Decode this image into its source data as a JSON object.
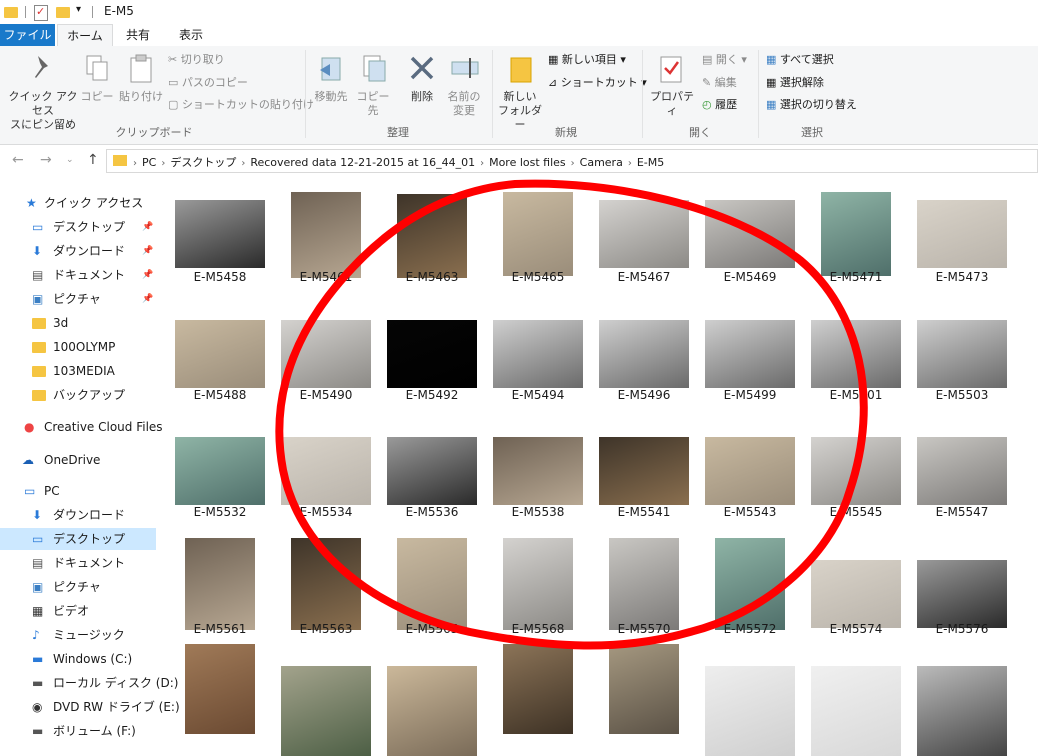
{
  "window": {
    "title": "E-M5"
  },
  "tabs": {
    "file": "ファイル",
    "home": "ホーム",
    "share": "共有",
    "view": "表示"
  },
  "ribbon": {
    "clipboard": {
      "label": "クリップボード",
      "pin": "クイック アクセス\nスにピン留め",
      "copy": "コピー",
      "paste": "貼り付け",
      "cut": "切り取り",
      "copy_path": "パスのコピー",
      "paste_shortcut": "ショートカットの貼り付け"
    },
    "organize": {
      "label": "整理",
      "move": "移動先",
      "copyto": "コピー先",
      "delete": "削除",
      "rename": "名前の\n変更"
    },
    "new": {
      "label": "新規",
      "new_folder": "新しい\nフォルダー",
      "new_item": "新しい項目 ▾",
      "shortcut": "ショートカット ▾"
    },
    "open": {
      "label": "開く",
      "properties": "プロパティ",
      "open": "開く ▾",
      "edit": "編集",
      "history": "履歴"
    },
    "select": {
      "label": "選択",
      "all": "すべて選択",
      "none": "選択解除",
      "invert": "選択の切り替え"
    }
  },
  "breadcrumbs": [
    "PC",
    "デスクトップ",
    "Recovered data 12-21-2015 at 16_44_01",
    "More lost files",
    "Camera",
    "E-M5"
  ],
  "sidebar": {
    "quick_access": "クイック アクセス",
    "qa_items": [
      "デスクトップ",
      "ダウンロード",
      "ドキュメント",
      "ピクチャ",
      "3d",
      "100OLYMP",
      "103MEDIA",
      "バックアップ"
    ],
    "creative_cloud": "Creative Cloud Files",
    "onedrive": "OneDrive",
    "pc": "PC",
    "pc_items": [
      "ダウンロード",
      "デスクトップ",
      "ドキュメント",
      "ピクチャ",
      "ビデオ",
      "ミュージック",
      "Windows (C:)",
      "ローカル ディスク (D:)",
      "DVD RW ドライブ (E:)",
      "ボリューム (F:)"
    ]
  },
  "files": {
    "row1": [
      "E-M5458",
      "E-M5461",
      "E-M5463",
      "E-M5465",
      "E-M5467",
      "E-M5469",
      "E-M5471",
      "E-M5473"
    ],
    "row2": [
      "E-M5488",
      "E-M5490",
      "E-M5492",
      "E-M5494",
      "E-M5496",
      "E-M5499",
      "E-M5501",
      "E-M5503"
    ],
    "row3": [
      "E-M5532",
      "E-M5534",
      "E-M5536",
      "E-M5538",
      "E-M5541",
      "E-M5543",
      "E-M5545",
      "E-M5547"
    ],
    "row4": [
      "E-M5561",
      "E-M5563",
      "E-M5565",
      "E-M5568",
      "E-M5570",
      "E-M5572",
      "E-M5574",
      "E-M5576"
    ]
  },
  "colors": {
    "accent": "#1979ca",
    "annotation": "#ff0000",
    "selection": "#cce8ff"
  }
}
